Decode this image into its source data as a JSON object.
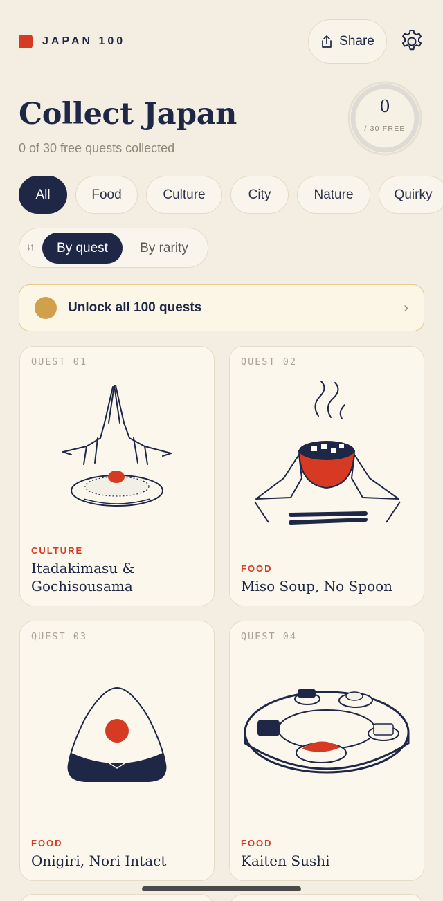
{
  "header": {
    "brand": "JAPAN 100",
    "share_label": "Share",
    "title": "Collect Japan",
    "subtitle": "0 of 30 free quests collected"
  },
  "progress": {
    "count": "0",
    "label": "/ 30 FREE",
    "fraction": 0
  },
  "filters": [
    "All",
    "Food",
    "Culture",
    "City",
    "Nature",
    "Quirky"
  ],
  "sort": {
    "options": [
      "By quest",
      "By rarity"
    ],
    "selected": "By quest"
  },
  "unlock": {
    "label": "Unlock all 100 quests"
  },
  "quests": [
    {
      "number": "QUEST 01",
      "category": "CULTURE",
      "title": "Itadakimasu & Gochisousama",
      "icon": "praying-hands-rice-icon"
    },
    {
      "number": "QUEST 02",
      "category": "FOOD",
      "title": "Miso Soup, No Spoon",
      "icon": "miso-bowl-icon"
    },
    {
      "number": "QUEST 03",
      "category": "FOOD",
      "title": "Onigiri, Nori Intact",
      "icon": "onigiri-icon"
    },
    {
      "number": "QUEST 04",
      "category": "FOOD",
      "title": "Kaiten Sushi",
      "icon": "sushi-conveyor-icon"
    }
  ],
  "colors": {
    "background": "#f3eee1",
    "navy": "#1f2747",
    "accent_red": "#d63a22",
    "gold": "#d1a04b"
  }
}
